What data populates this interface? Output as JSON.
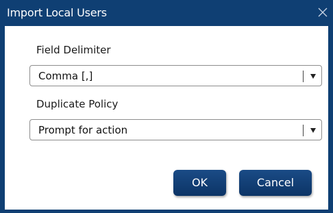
{
  "dialog": {
    "title": "Import Local Users",
    "close_icon": "close-icon"
  },
  "fields": [
    {
      "label": "Field Delimiter",
      "value": "Comma [,]"
    },
    {
      "label": "Duplicate Policy",
      "value": "Prompt for action"
    }
  ],
  "buttons": {
    "ok_label": "OK",
    "cancel_label": "Cancel"
  },
  "colors": {
    "title_bar": "#0f3f73",
    "button": "#0c3466"
  }
}
